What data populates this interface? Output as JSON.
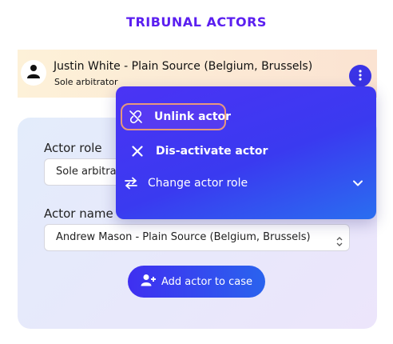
{
  "page": {
    "title": "TRIBUNAL ACTORS"
  },
  "actor": {
    "name": "Justin White - Plain Source (Belgium, Brussels)",
    "role": "Sole arbitrator"
  },
  "menu": {
    "items": [
      {
        "label": "Unlink actor",
        "icon": "unlink-icon"
      },
      {
        "label": "Dis-activate actor",
        "icon": "close-icon"
      },
      {
        "label": "Change actor role",
        "icon": "swap-icon",
        "trailing_icon": "chevron-down-icon"
      }
    ]
  },
  "form": {
    "actor_role_label": "Actor role",
    "actor_role_value": "Sole arbitrator",
    "actor_name_label": "Actor name",
    "actor_name_value": "Andrew Mason - Plain Source (Belgium, Brussels)",
    "add_button_label": "Add actor to case"
  },
  "colors": {
    "accent": "#5b1ff0",
    "menu_gradient_start": "#4b33f5",
    "menu_gradient_end": "#2a6ef0",
    "focus_ring": "#e7987c"
  }
}
